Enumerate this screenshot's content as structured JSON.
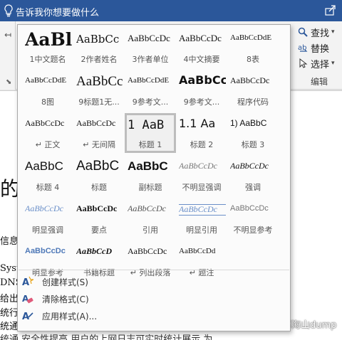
{
  "titlebar": {
    "tell_me": "告诉我你想要做什么",
    "icons": [
      "lightbulb-icon",
      "share-icon"
    ]
  },
  "ribbon": {
    "editing": {
      "find": "查找",
      "replace": "替换",
      "select": "选择",
      "group_label": "编辑"
    }
  },
  "gallery": {
    "styles": [
      {
        "preview": "AaBl",
        "name": "1中文题名"
      },
      {
        "preview": "AaBbCc",
        "name": "2作者姓名"
      },
      {
        "preview": "AaBbCcDc",
        "name": "3作者单位"
      },
      {
        "preview": "AaBbCcDc",
        "name": "4中文摘要"
      },
      {
        "preview": "AaBbCcDdE",
        "name": "8表"
      },
      {
        "preview": "AaBbCcDdE",
        "name": "8图"
      },
      {
        "preview": "AaBbCc",
        "name": "9标题1无..."
      },
      {
        "preview": "AaBbCcDdE",
        "name": "9参考文..."
      },
      {
        "preview": "AaBbCc",
        "name": "9参考文..."
      },
      {
        "preview": "AaBbCcDc",
        "name": "程序代码"
      },
      {
        "preview": "AaBbCcDc",
        "name": "↵ 正文"
      },
      {
        "preview": "AaBbCcDc",
        "name": "↵ 无间隔"
      },
      {
        "preview": "1 AaB",
        "name": "标题 1"
      },
      {
        "preview": "1.1 Aa",
        "name": "标题 2"
      },
      {
        "preview": "1) AaBbC",
        "name": "标题 3"
      },
      {
        "preview": "AaBbC",
        "name": "标题 4"
      },
      {
        "preview": "AaBbC",
        "name": "标题"
      },
      {
        "preview": "AaBbC",
        "name": "副标题"
      },
      {
        "preview": "AaBbCcDc",
        "name": "不明显强调"
      },
      {
        "preview": "AaBbCcDc",
        "name": "强调"
      },
      {
        "preview": "AaBbCcDc",
        "name": "明显强调"
      },
      {
        "preview": "AaBbCcDc",
        "name": "要点"
      },
      {
        "preview": "AaBbCcDc",
        "name": "引用"
      },
      {
        "preview": "AaBbCcDc",
        "name": "明显引用"
      },
      {
        "preview": "AaBbCcDc",
        "name": "不明显参考"
      },
      {
        "preview": "AaBbCcDc",
        "name": "明显参考"
      },
      {
        "preview": "AaBbCcD",
        "name": "书籍标题"
      },
      {
        "preview": "AaBbCcDc",
        "name": "↵ 列出段落"
      },
      {
        "preview": "AaBbCcDd",
        "name": "↵ 题注"
      }
    ],
    "selected_style": "标题 1",
    "commands": [
      {
        "label": "创建样式(S)",
        "icon": "create-style-icon"
      },
      {
        "label": "清除格式(C)",
        "icon": "clear-formatting-icon"
      },
      {
        "label": "应用样式(A)...",
        "icon": "apply-styles-icon"
      }
    ]
  },
  "document": {
    "fragments": [
      "的",
      "信息身",
      "Syste",
      "DNS",
      "给出",
      "统行状",
      "统通",
      "运行状"
    ],
    "bottom_line": "统通 安全性提高 用户的上网日志可实时统计展示 为"
  },
  "watermark": "郑海山dump",
  "colors": {
    "titlebar_blue": "#2b579a",
    "selected_border": "#bdbdbd",
    "emphasis_blue": "#6a8fc8"
  }
}
